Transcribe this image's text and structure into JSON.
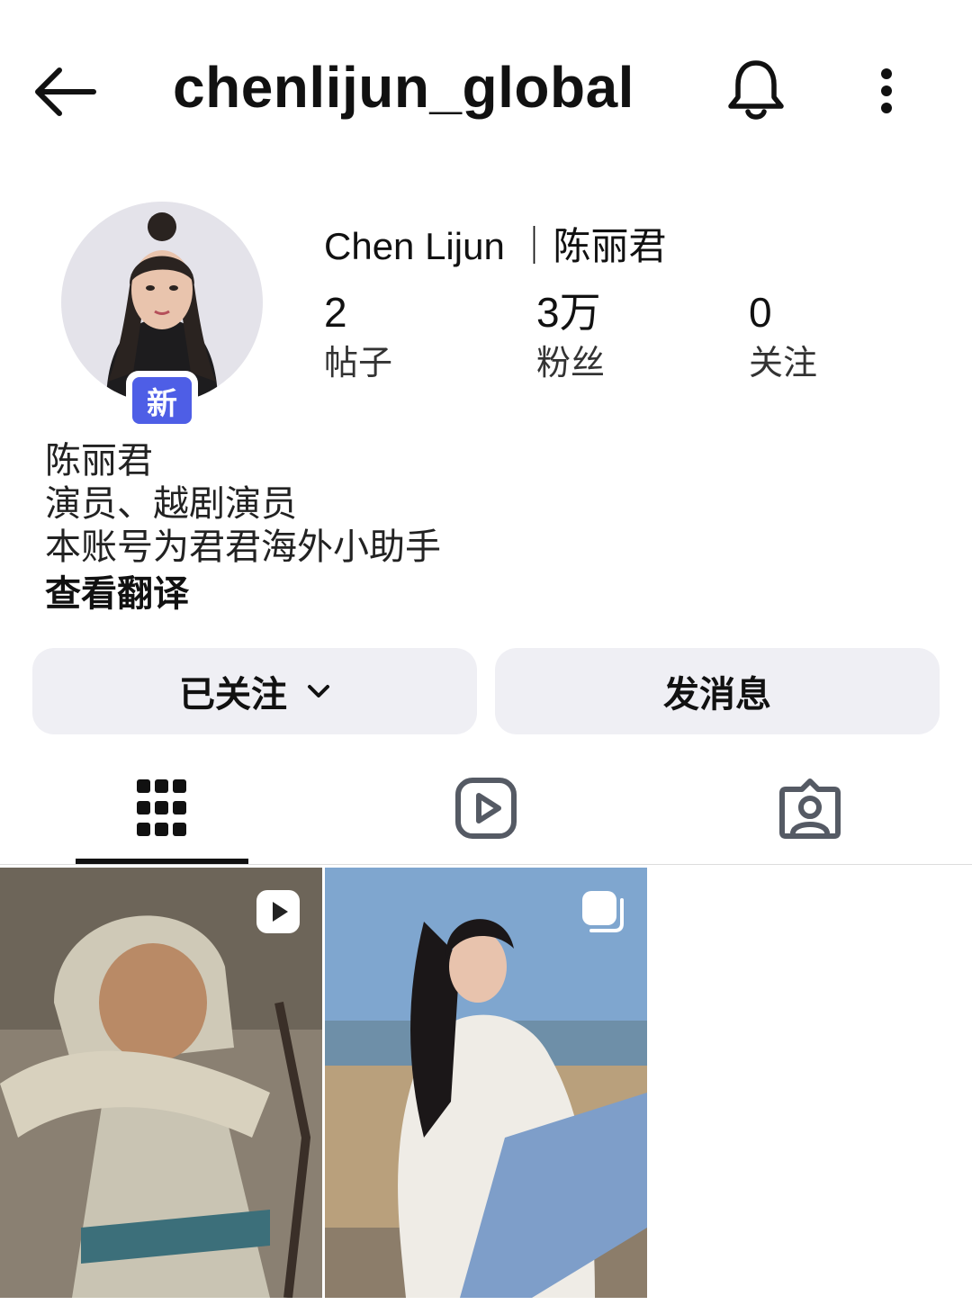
{
  "header": {
    "username": "chenlijun_global",
    "icons": {
      "back": "arrow-left-icon",
      "notifications": "bell-icon",
      "more": "more-vertical-icon"
    }
  },
  "profile": {
    "display_name": "Chen Lijun  ｜陈丽君",
    "badge_label": "新",
    "stats": [
      {
        "value": "2",
        "label": "帖子"
      },
      {
        "value": "3万",
        "label": "粉丝"
      },
      {
        "value": "0",
        "label": "关注"
      }
    ],
    "bio_lines": [
      "陈丽君",
      "演员、越剧演员",
      "本账号为君君海外小助手"
    ],
    "translate_link": "查看翻译"
  },
  "actions": {
    "following_label": "已关注",
    "message_label": "发消息"
  },
  "tabs": [
    {
      "icon": "grid-icon",
      "selected": true
    },
    {
      "icon": "reels-icon",
      "selected": false
    },
    {
      "icon": "tagged-icon",
      "selected": false
    }
  ],
  "posts": [
    {
      "type": "video",
      "badge_icon": "reel-badge-icon"
    },
    {
      "type": "carousel",
      "badge_icon": "carousel-badge-icon"
    }
  ],
  "colors": {
    "accent_badge": "#4e5ee6",
    "button_bg": "#efeff4",
    "text": "#111111"
  }
}
